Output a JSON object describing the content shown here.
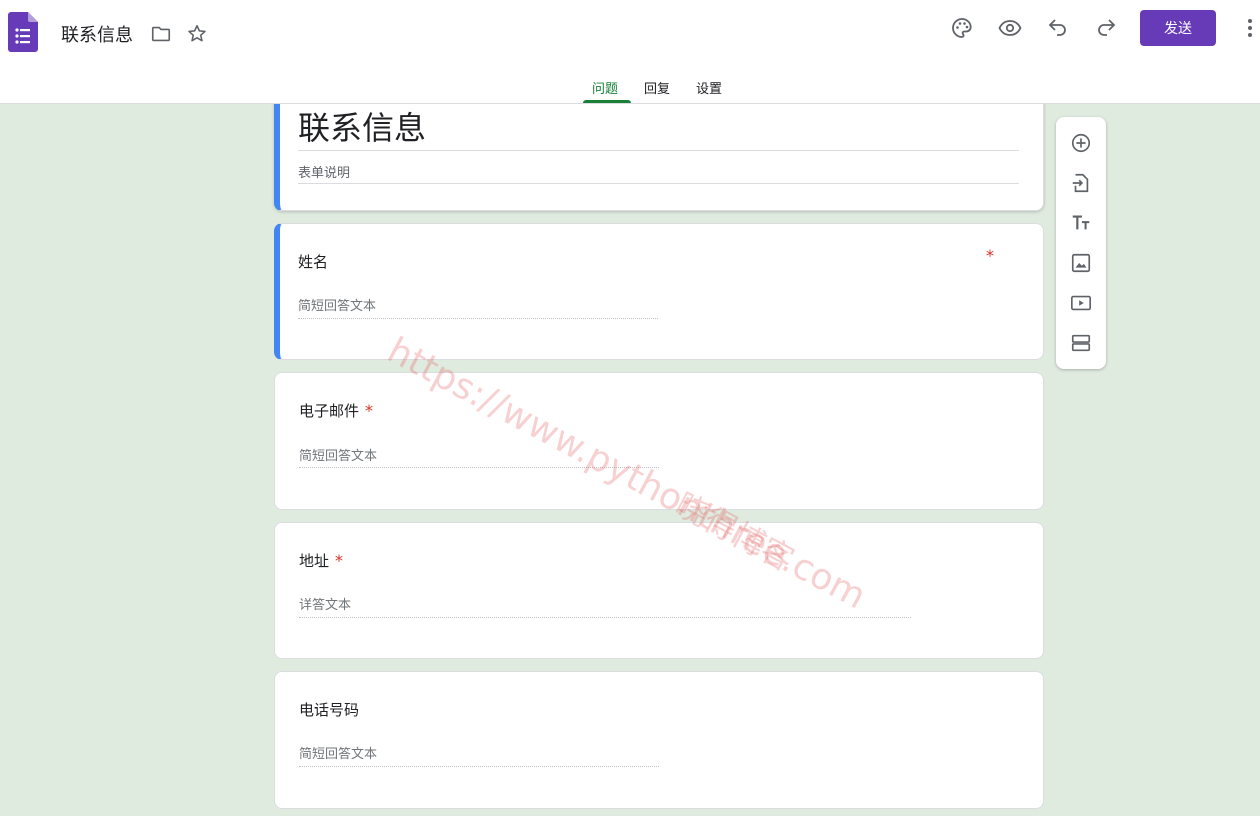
{
  "header": {
    "doc_title": "联系信息",
    "send_label": "发送",
    "icons": [
      "folder-icon",
      "star-icon",
      "palette-icon",
      "eye-icon",
      "undo-icon",
      "redo-icon",
      "more-vert-icon"
    ]
  },
  "tabs": [
    {
      "label": "问题",
      "active": true
    },
    {
      "label": "回复",
      "active": false
    },
    {
      "label": "设置",
      "active": false
    }
  ],
  "form": {
    "title": "联系信息",
    "description_placeholder": "表单说明"
  },
  "questions": [
    {
      "title": "姓名",
      "required": true,
      "hint": "简短回答文本"
    },
    {
      "title": "电子邮件",
      "required": true,
      "hint": "简短回答文本"
    },
    {
      "title": "地址",
      "required": true,
      "hint": "详答文本"
    },
    {
      "title": "电话号码",
      "required": false,
      "hint": "简短回答文本"
    }
  ],
  "required_mark": "*",
  "toolbar": [
    "add-question-icon",
    "import-questions-icon",
    "add-title-icon",
    "add-image-icon",
    "add-video-icon",
    "add-section-icon"
  ],
  "watermark": {
    "url": "https://www.pythonthree.com",
    "name": "晓得博客"
  },
  "colors": {
    "accent": "#673ab7",
    "tab_active": "#188038",
    "selected_border": "#4285f4",
    "background": "#e0ebe0",
    "required": "#d93025"
  }
}
